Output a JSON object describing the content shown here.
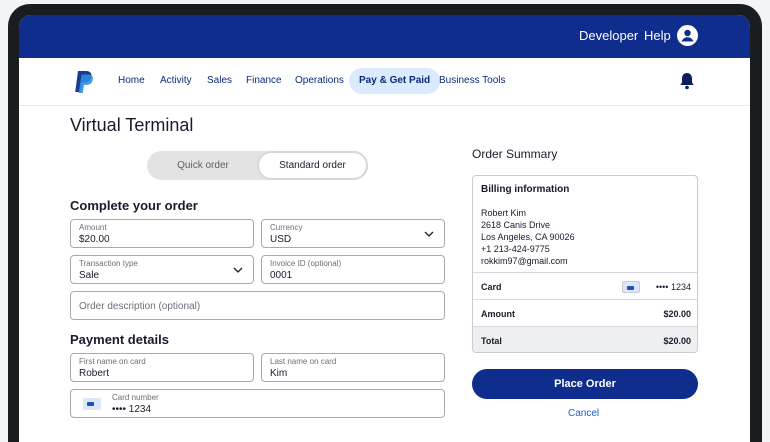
{
  "topbar": {
    "developer": "Developer",
    "help": "Help"
  },
  "nav": {
    "items": [
      "Home",
      "Activity",
      "Sales",
      "Finance",
      "Operations",
      "Pay & Get Paid",
      "Business Tools"
    ],
    "active": "Pay & Get Paid"
  },
  "page": {
    "title": "Virtual Terminal"
  },
  "order_toggle": {
    "quick": "Quick order",
    "standard": "Standard order",
    "selected": "Standard order"
  },
  "complete_order": {
    "title": "Complete your order",
    "amount": {
      "label": "Amount",
      "value": "$20.00"
    },
    "currency": {
      "label": "Currency",
      "value": "USD"
    },
    "transaction_type": {
      "label": "Transaction type",
      "value": "Sale"
    },
    "invoice_id": {
      "label": "Invoice ID (optional)",
      "value": "0001"
    },
    "description": {
      "placeholder": "Order description (optional)"
    }
  },
  "payment": {
    "title": "Payment details",
    "first_name": {
      "label": "First name on card",
      "value": "Robert"
    },
    "last_name": {
      "label": "Last name on card",
      "value": "Kim"
    },
    "card_number": {
      "label": "Card number",
      "value": "•••• 1234"
    }
  },
  "summary": {
    "title": "Order Summary",
    "billing_title": "Billing information",
    "billing_lines": [
      "Robert Kim",
      "2618 Canis Drive",
      "Los Angeles, CA 90026",
      "+1 213-424-9775",
      "rokkim97@gmail.com"
    ],
    "card_label": "Card",
    "card_value": "•••• 1234",
    "amount_label": "Amount",
    "amount_value": "$20.00",
    "total_label": "Total",
    "total_value": "$20.00"
  },
  "actions": {
    "place_order": "Place Order",
    "cancel": "Cancel"
  },
  "colors": {
    "brand_navy": "#0f2d8c",
    "accent_light": "#dbeafd",
    "link_blue": "#1f5dd6"
  },
  "icons": [
    "paypal-logo-icon",
    "user-avatar-icon",
    "bell-icon",
    "chevron-down-icon",
    "card-icon"
  ]
}
